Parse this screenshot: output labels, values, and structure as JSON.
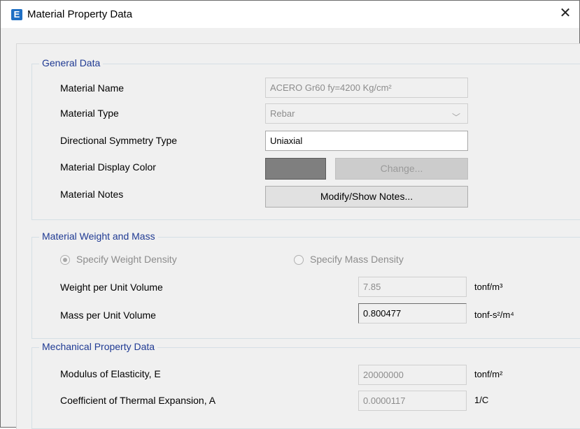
{
  "window": {
    "title": "Material Property Data",
    "app_icon_letter": "E",
    "close_glyph": "✕"
  },
  "general": {
    "legend": "General Data",
    "material_name_label": "Material Name",
    "material_name_value": "ACERO Gr60 fy=4200 Kg/cm²",
    "material_type_label": "Material Type",
    "material_type_value": "Rebar",
    "symmetry_label": "Directional Symmetry Type",
    "symmetry_value": "Uniaxial",
    "display_color_label": "Material Display Color",
    "display_color": "#7f7f7f",
    "change_button": "Change...",
    "notes_label": "Material Notes",
    "notes_button": "Modify/Show Notes..."
  },
  "weight_mass": {
    "legend": "Material Weight and Mass",
    "specify_weight_label": "Specify Weight Density",
    "specify_weight_selected": true,
    "specify_mass_label": "Specify Mass Density",
    "specify_mass_selected": false,
    "weight_label": "Weight per Unit Volume",
    "weight_value": "7.85",
    "weight_unit": "tonf/m³",
    "mass_label": "Mass per Unit Volume",
    "mass_value": "0.800477",
    "mass_unit": "tonf-s²/m⁴"
  },
  "mechanical": {
    "legend": "Mechanical Property Data",
    "modulus_label": "Modulus of Elasticity,  E",
    "modulus_value": "20000000",
    "modulus_unit": "tonf/m²",
    "thermal_label": "Coefficient of Thermal Expansion,  A",
    "thermal_value": "0.0000117",
    "thermal_unit": "1/C"
  },
  "colors": {
    "legend_text": "#1f3a93",
    "app_icon": "#1e6fc4"
  }
}
